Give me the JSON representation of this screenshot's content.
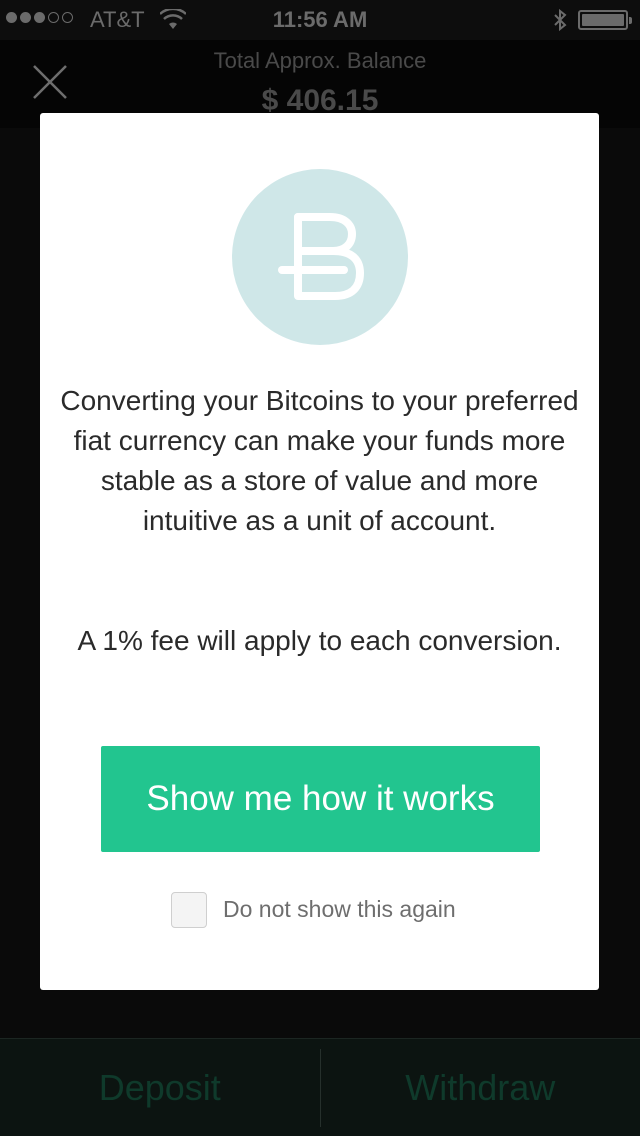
{
  "status_bar": {
    "carrier": "AT&T",
    "time": "11:56 AM",
    "signal_bars_filled": 3,
    "signal_bars_total": 5,
    "battery_level": 1.0,
    "icons": [
      "signal-icon",
      "wifi-icon",
      "bluetooth-icon",
      "battery-icon"
    ]
  },
  "header": {
    "balance_label": "Total Approx. Balance",
    "balance_value": "$ 406.15",
    "close_icon": "close-icon"
  },
  "modal": {
    "logo_icon": "bitreserve-b-icon",
    "message": "Converting your Bitcoins to your preferred fiat currency can make your funds more stable as a store of value and more intuitive as a unit of account.",
    "fee_note": "A 1% fee will apply to each conversion.",
    "cta_label": "Show me how it works",
    "checkbox_label": "Do not show this again",
    "checkbox_checked": false
  },
  "bottom_bar": {
    "deposit_label": "Deposit",
    "withdraw_label": "Withdraw"
  },
  "colors": {
    "accent": "#22c58f",
    "logo_circle": "#cfe7e8",
    "overlay": "#0a0a0a",
    "bottom_tab_text": "#0f3a2b"
  }
}
